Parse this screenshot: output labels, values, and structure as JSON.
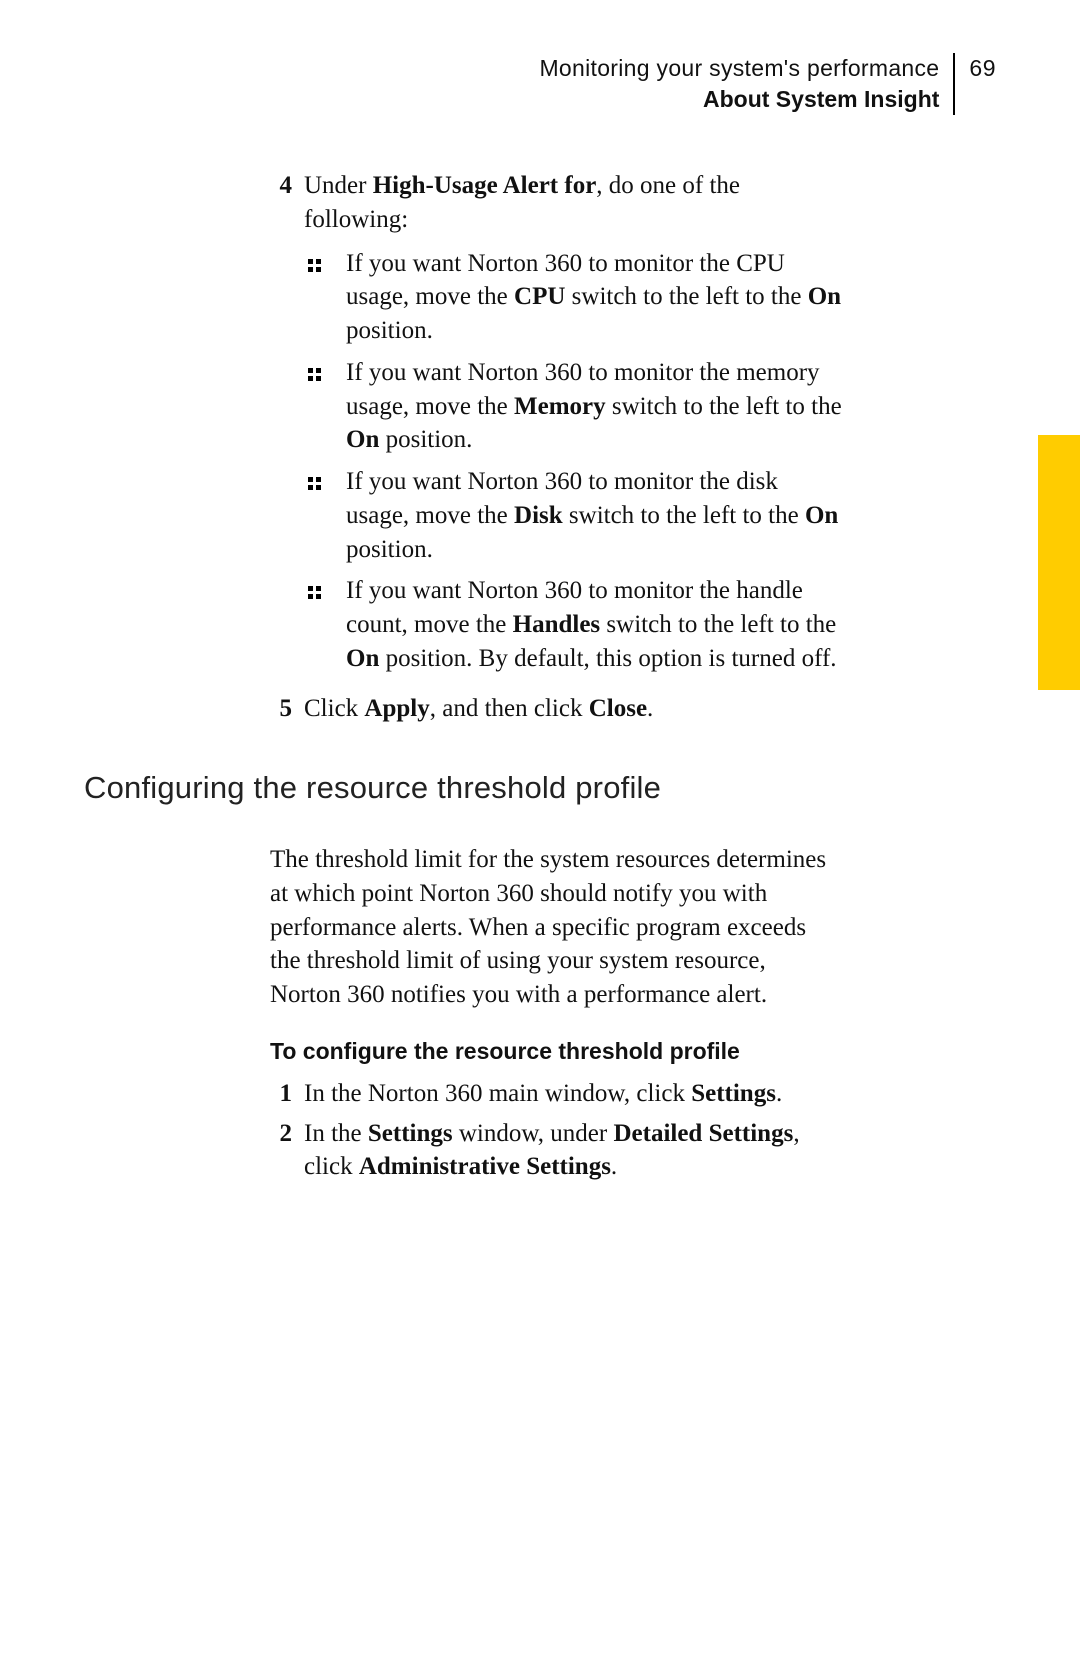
{
  "header": {
    "line1": "Monitoring your system's performance",
    "line2": "About System Insight",
    "page_number": "69"
  },
  "step4": {
    "num": "4",
    "lead_pre": "Under ",
    "lead_bold1": "High-Usage Alert for",
    "lead_post": ", do one of the following:",
    "bullets": {
      "b1": {
        "p1": "If you want Norton 360 to monitor the CPU usage, move the ",
        "bold1": "CPU",
        "p2": " switch to the left to the ",
        "bold2": "On",
        "p3": " position."
      },
      "b2": {
        "p1": "If you want Norton 360 to monitor the memory usage, move the ",
        "bold1": "Memory",
        "p2": " switch to the left to the ",
        "bold2": "On",
        "p3": " position."
      },
      "b3": {
        "p1": "If you want Norton 360 to monitor the disk usage, move the ",
        "bold1": "Disk",
        "p2": " switch to the left to the ",
        "bold2": "On",
        "p3": " position."
      },
      "b4": {
        "p1": "If you want Norton 360 to monitor the handle count, move the ",
        "bold1": "Handles",
        "p2": " switch to the left to the ",
        "bold2": "On",
        "p3": " position. By default, this option is turned off."
      }
    }
  },
  "step5": {
    "num": "5",
    "p1": "Click ",
    "bold1": "Apply",
    "p2": ", and then click ",
    "bold2": "Close",
    "p3": "."
  },
  "section_title": "Configuring the resource threshold profile",
  "section_para": "The threshold limit for the system resources determines at which point Norton 360 should notify you with performance alerts. When a specific program exceeds the threshold limit of using your system resource, Norton 360 notifies you with a performance alert.",
  "task_heading": "To configure the resource threshold profile",
  "task_steps": {
    "s1": {
      "num": "1",
      "p1": "In the Norton 360 main window, click ",
      "bold1": "Settings",
      "p2": "."
    },
    "s2": {
      "num": "2",
      "p1": "In the ",
      "bold1": "Settings",
      "p2": " window, under ",
      "bold2": "Detailed Settings",
      "p3": ", click ",
      "bold3": "Administrative Settings",
      "p4": "."
    }
  }
}
